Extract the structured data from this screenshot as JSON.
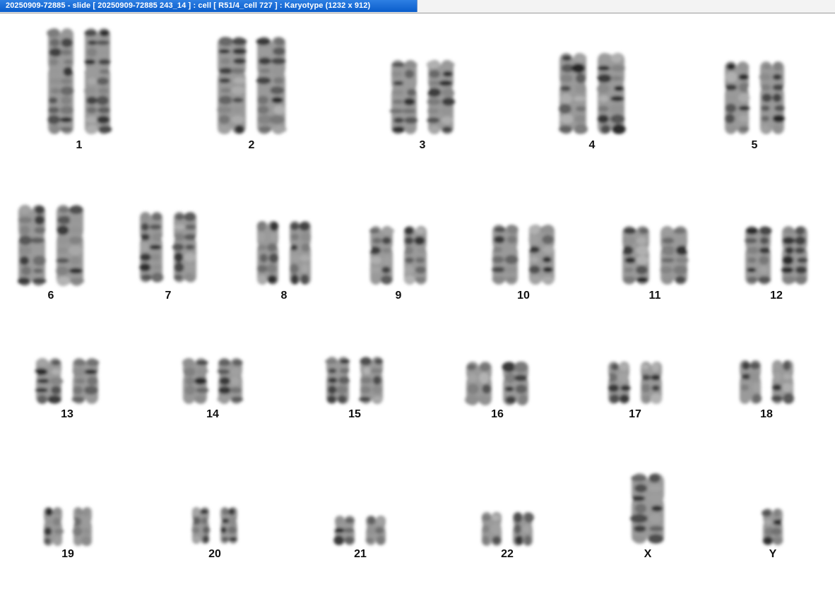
{
  "window": {
    "title": "20250909-72885 - slide [ 20250909-72885 243_14 ] : cell [ R51/4_cell 727 ] : Karyotype  (1232 x 912)"
  },
  "karyotype": {
    "chromosomes": [
      {
        "label": "1",
        "count": 2
      },
      {
        "label": "2",
        "count": 2
      },
      {
        "label": "3",
        "count": 2
      },
      {
        "label": "4",
        "count": 2
      },
      {
        "label": "5",
        "count": 2
      },
      {
        "label": "6",
        "count": 2
      },
      {
        "label": "7",
        "count": 2
      },
      {
        "label": "8",
        "count": 2
      },
      {
        "label": "9",
        "count": 2
      },
      {
        "label": "10",
        "count": 2
      },
      {
        "label": "11",
        "count": 2
      },
      {
        "label": "12",
        "count": 2
      },
      {
        "label": "13",
        "count": 2
      },
      {
        "label": "14",
        "count": 2
      },
      {
        "label": "15",
        "count": 2
      },
      {
        "label": "16",
        "count": 2
      },
      {
        "label": "17",
        "count": 2
      },
      {
        "label": "18",
        "count": 2
      },
      {
        "label": "19",
        "count": 2
      },
      {
        "label": "20",
        "count": 2
      },
      {
        "label": "21",
        "count": 2
      },
      {
        "label": "22",
        "count": 2
      },
      {
        "label": "X",
        "count": 1
      },
      {
        "label": "Y",
        "count": 1
      }
    ]
  }
}
